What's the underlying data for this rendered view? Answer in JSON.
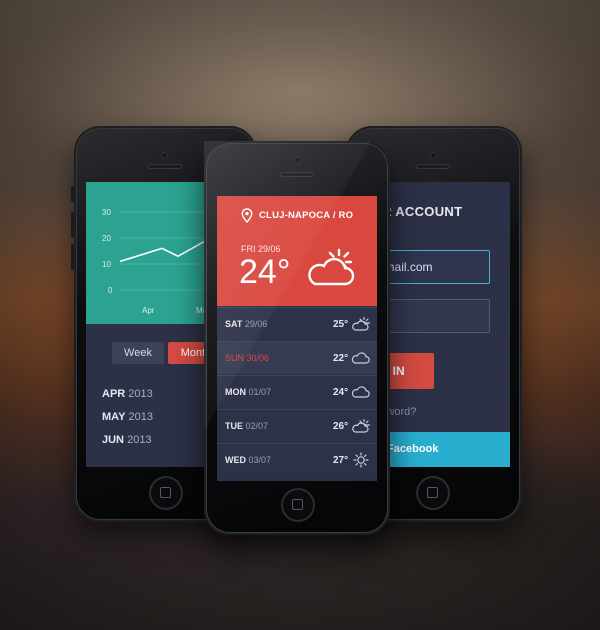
{
  "left_phone": {
    "chart_data": {
      "type": "line",
      "y_ticks": [
        "30",
        "20",
        "10",
        "0"
      ],
      "x_labels": [
        "Apr",
        "Ma"
      ],
      "series": [
        {
          "values": [
            11,
            16,
            13,
            19
          ]
        }
      ],
      "ylim": [
        0,
        30
      ],
      "grid": true,
      "color": "#ffffff"
    },
    "segments": {
      "week": "Week",
      "month": "Mont"
    },
    "months": [
      {
        "month": "APR",
        "year": "2013"
      },
      {
        "month": "MAY",
        "year": "2013"
      },
      {
        "month": "JUN",
        "year": "2013"
      }
    ]
  },
  "center_phone": {
    "location": "CLUJ-NAPOCA / RO",
    "current": {
      "date": "FRI 29/06",
      "temp": "24°",
      "icon": "cloud-sun-icon"
    },
    "forecast": [
      {
        "day": "SAT",
        "date": "29/06",
        "temp": "25°",
        "icon": "partly-cloudy-icon",
        "selected": false
      },
      {
        "day": "SUN",
        "date": "30/06",
        "temp": "22°",
        "icon": "cloud-icon",
        "selected": true
      },
      {
        "day": "MON",
        "date": "01/07",
        "temp": "24°",
        "icon": "cloud-icon",
        "selected": false
      },
      {
        "day": "TUE",
        "date": "02/07",
        "temp": "26°",
        "icon": "partly-cloudy-icon",
        "selected": false
      },
      {
        "day": "WED",
        "date": "03/07",
        "temp": "27°",
        "icon": "sun-icon",
        "selected": false
      }
    ],
    "colors": {
      "header": "#d9483f",
      "body": "#2d3147"
    }
  },
  "right_phone": {
    "title": "OUR ACCOUNT",
    "email_value": "e@gmail.com",
    "signin_label": "GN IN",
    "forgot_label": "Password?",
    "facebook_label": "with Facebook",
    "colors": {
      "signin": "#d44b42",
      "facebook": "#29aed0",
      "focus": "#45b5c4"
    }
  }
}
